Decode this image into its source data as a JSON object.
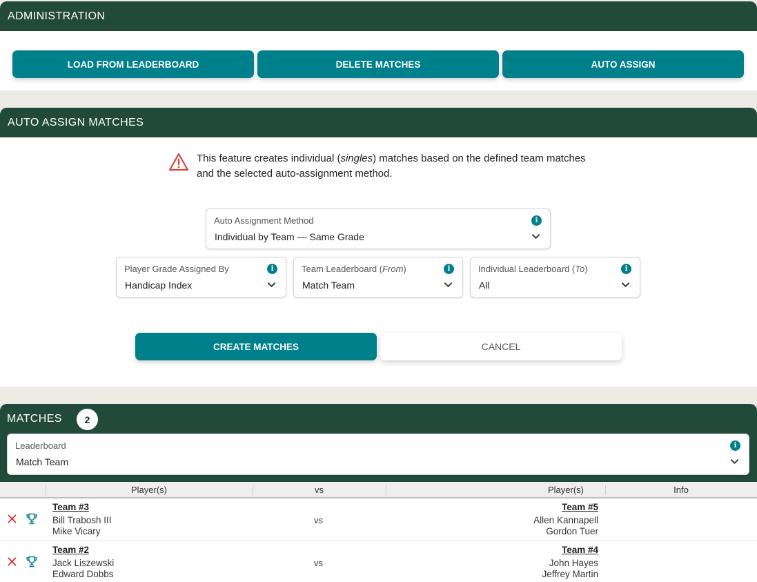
{
  "admin": {
    "title": "ADMINISTRATION",
    "buttons": {
      "load": "LOAD FROM LEADERBOARD",
      "delete": "DELETE MATCHES",
      "auto_assign": "AUTO ASSIGN"
    }
  },
  "auto_assign": {
    "title": "AUTO ASSIGN MATCHES",
    "notice": {
      "before": "This feature creates individual (",
      "emph": "singles",
      "after": ") matches based on the defined team matches and the selected auto-assignment method."
    },
    "method": {
      "label": "Auto Assignment Method",
      "value": "Individual by Team — Same Grade"
    },
    "grade": {
      "label": "Player Grade Assigned By",
      "value": "Handicap Index"
    },
    "team_lb": {
      "label": "Team Leaderboard (",
      "label_emph": "From",
      "label_end": ")",
      "value": "Match Team"
    },
    "indiv_lb": {
      "label": "Individual Leaderboard (",
      "label_emph": "To",
      "label_end": ")",
      "value": "All"
    },
    "create_label": "CREATE MATCHES",
    "cancel_label": "CANCEL"
  },
  "matches": {
    "title": "MATCHES",
    "count": "2",
    "leaderboard": {
      "label": "Leaderboard",
      "value": "Match Team"
    },
    "columns": {
      "players_left": "Player(s)",
      "vs": "vs",
      "players_right": "Player(s)",
      "info": "Info"
    },
    "rows": [
      {
        "team_left": "Team #3",
        "players_left": [
          "Bill Trabosh III",
          "Mike Vicary"
        ],
        "vs": "vs",
        "team_right": "Team #5",
        "players_right": [
          "Allen Kannapell",
          "Gordon Tuer"
        ]
      },
      {
        "team_left": "Team #2",
        "players_left": [
          "Jack Liszewski",
          "Edward Dobbs"
        ],
        "vs": "vs",
        "team_right": "Team #4",
        "players_right": [
          "John Hayes",
          "Jeffrey Martin"
        ]
      }
    ]
  },
  "icons": {
    "warning": "warning-triangle-icon",
    "info": "info-icon",
    "chevron": "chevron-down-icon",
    "delete": "close-icon",
    "trophy": "trophy-icon"
  },
  "colors": {
    "header_bg": "#214a3a",
    "accent": "#00808a",
    "warning": "#d9453a",
    "delete": "#d32f2f",
    "page_bg": "#ecebe6"
  }
}
